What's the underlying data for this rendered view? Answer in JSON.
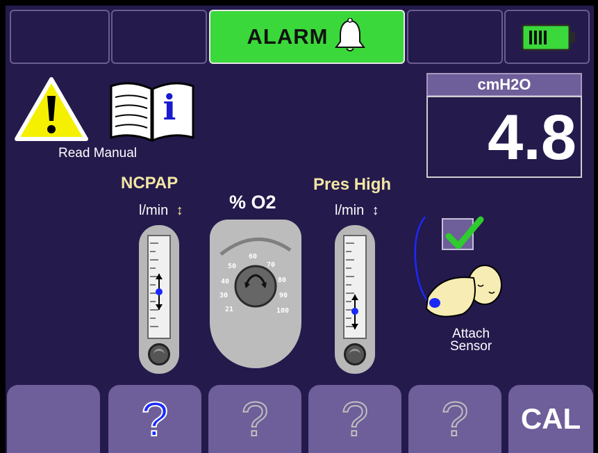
{
  "top_bar": {
    "alarm_label": "ALARM"
  },
  "notice": {
    "read_manual": "Read Manual"
  },
  "pressure": {
    "unit": "cmH2O",
    "value": "4.8"
  },
  "ncpap": {
    "title": "NCPAP",
    "unit": "l/min"
  },
  "oxygen": {
    "title": "% O2",
    "scale": [
      "21",
      "30",
      "40",
      "50",
      "60",
      "70",
      "80",
      "90",
      "100"
    ]
  },
  "pres_high": {
    "title": "Pres High",
    "unit": "l/min"
  },
  "sensor": {
    "label_line1": "Attach",
    "label_line2": "Sensor"
  },
  "bottom_bar": {
    "help_label": "?",
    "cal_label": "CAL"
  },
  "colors": {
    "background": "#241a4c",
    "alarm_green": "#3ad83a",
    "button_purple": "#6e5e99",
    "check_green": "#2ecc2e"
  }
}
